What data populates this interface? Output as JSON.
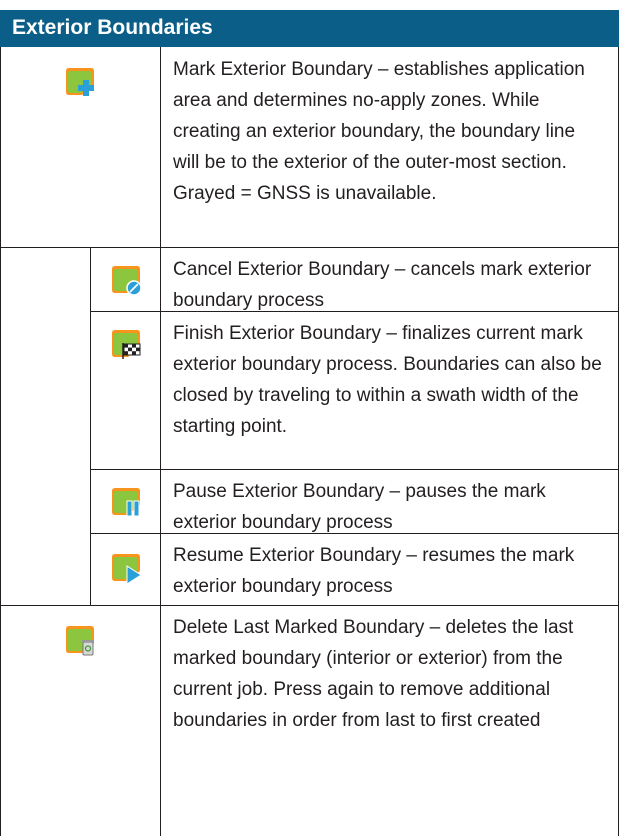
{
  "table": {
    "header": "Exterior Boundaries",
    "rows": [
      {
        "icon": "mark-exterior-boundary-icon",
        "text": "Mark Exterior Boundary – establishes application area and determines no-apply zones. While creating an exterior boundary, the boundary line will be to the exterior of the outer-most section. Grayed = GNSS is unavailable."
      },
      {
        "icon": "cancel-exterior-boundary-icon",
        "text": "Cancel Exterior Boundary – cancels mark exterior boundary process"
      },
      {
        "icon": "finish-exterior-boundary-icon",
        "text": "Finish Exterior Boundary – finalizes current mark exterior boundary process. Boundaries can also be closed by traveling to within a swath width of the starting point."
      },
      {
        "icon": "pause-exterior-boundary-icon",
        "text": "Pause Exterior Boundary – pauses the mark exterior boundary process"
      },
      {
        "icon": "resume-exterior-boundary-icon",
        "text": "Resume Exterior Boundary – resumes the mark exterior boundary process"
      },
      {
        "icon": "delete-last-boundary-icon",
        "text": "Delete Last Marked Boundary – deletes the last marked boundary (interior or exterior) from the current job. Press again to remove additional boundaries in order from last to first created"
      }
    ]
  },
  "colors": {
    "header_bg": "#0b5e87",
    "icon_green": "#8cc63f",
    "icon_orange": "#f7941d",
    "icon_blue": "#2a9fd8"
  }
}
